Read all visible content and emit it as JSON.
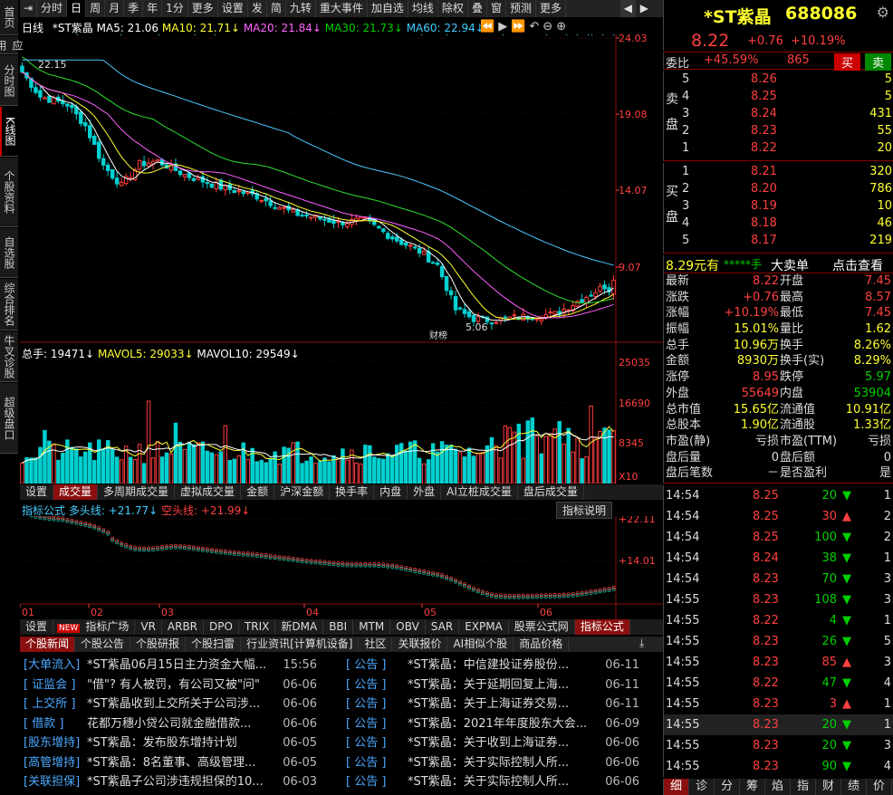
{
  "vtabs": [
    {
      "label": "首页"
    },
    {
      "label": "应用"
    },
    {
      "label": "分时图"
    },
    {
      "label": "K线图"
    },
    {
      "label": "个股资料"
    },
    {
      "label": "自选股"
    },
    {
      "label": "综合排名"
    },
    {
      "label": "牛叉诊股"
    },
    {
      "label": "超级盘口"
    }
  ],
  "toolbar": [
    "分时",
    "日",
    "周",
    "月",
    "季",
    "年",
    "1分",
    "更多",
    "设置",
    "",
    "发",
    "简",
    "九转",
    "重大事件",
    "",
    "加自选",
    "均线",
    "除权",
    "叠",
    "窗",
    "预测",
    "更多"
  ],
  "toolbar_active": "日",
  "ma_line": {
    "type": "日线",
    "name": "*ST紫晶",
    "ma5": "MA5: 21.06",
    "ma10": "MA10: 21.71",
    "ma20": "MA20: 21.84",
    "ma30": "MA30: 21.73",
    "ma60": "MA60: 22.94"
  },
  "price_axis": [
    "24.03",
    "19.08",
    "14.07",
    "9.07"
  ],
  "price_high_label": "22.15",
  "price_low_label": "5.06",
  "event_label": "财榜",
  "vol_header": {
    "total": "总手: 19471",
    "mavol5": "MAVOL5: 29033",
    "mavol10": "MAVOL10: 29549"
  },
  "vol_axis": [
    "25035",
    "16690",
    "8345",
    "X10"
  ],
  "vol_tabs": [
    "设置",
    "成交量",
    "多周期成交量",
    "虚拟成交量",
    "金额",
    "沪深金额",
    "换手率",
    "内盘",
    "外盘",
    "AI立桩成交量",
    "盘后成交量"
  ],
  "vol_tab_active": "成交量",
  "ind_header": {
    "title": "指标公式",
    "long": "多头线: +21.77",
    "short": "空头线: +21.99",
    "explain": "指标说明"
  },
  "ind_axis": [
    "+22.11",
    "+14.01"
  ],
  "months": [
    "01",
    "02",
    "03",
    "04",
    "05",
    "06"
  ],
  "ind_tabs": [
    "设置",
    "指标广场",
    "VR",
    "ARBR",
    "DPO",
    "TRIX",
    "新DMA",
    "BBI",
    "MTM",
    "OBV",
    "SAR",
    "EXPMA",
    "股票公式网",
    "指标公式"
  ],
  "ind_tab_active": "指标公式",
  "ind_new": "NEW",
  "news_tabs": [
    "个股新闻",
    "个股公告",
    "个股研报",
    "个股扫雷",
    "行业资讯[计算机设备]",
    "社区",
    "关联报价",
    "AI相似个股",
    "商品价格"
  ],
  "news_left": [
    {
      "tag": "[大单流入]",
      "title": "*ST紫晶06月15日主力资金大幅...",
      "date": "15:56"
    },
    {
      "tag": "[ 证监会 ]",
      "title": "\"借\"? 有人被罚，有公司又被\"问\"",
      "date": "06-06"
    },
    {
      "tag": "[ 上交所 ]",
      "title": "*ST紫晶收到上交所关于公司涉...",
      "date": "06-06"
    },
    {
      "tag": "[  借款  ]",
      "title": "花都万穗小贷公司就金融借款...",
      "date": "06-06"
    },
    {
      "tag": "[股东增持]",
      "title": "*ST紫晶：发布股东增持计划",
      "date": "06-05"
    },
    {
      "tag": "[高管增持]",
      "title": "*ST紫晶：8名董事、高级管理...",
      "date": "06-05"
    },
    {
      "tag": "[关联担保]",
      "title": "*ST紫晶子公司涉违规担保的10...",
      "date": "06-03"
    }
  ],
  "news_right": [
    {
      "tag": "[  公告  ]",
      "title": "*ST紫晶：中信建投证券股份...",
      "date": "06-11"
    },
    {
      "tag": "[  公告  ]",
      "title": "*ST紫晶：关于延期回复上海...",
      "date": "06-11"
    },
    {
      "tag": "[  公告  ]",
      "title": "*ST紫晶：关于上海证券交易...",
      "date": "06-11"
    },
    {
      "tag": "[  公告  ]",
      "title": "*ST紫晶：2021年年度股东大会...",
      "date": "06-09"
    },
    {
      "tag": "[  公告  ]",
      "title": "*ST紫晶：关于收到上海证券...",
      "date": "06-06"
    },
    {
      "tag": "[  公告  ]",
      "title": "*ST紫晶：关于实际控制人所...",
      "date": "06-06"
    },
    {
      "tag": "[  公告  ]",
      "title": "*ST紫晶：关于实际控制人所...",
      "date": "06-06"
    }
  ],
  "quote": {
    "name": "*ST紫晶",
    "code": "688086",
    "price": "8.22",
    "change": "+0.76",
    "pct": "+10.19%"
  },
  "weibi": {
    "label": "委比",
    "value": "+45.59%",
    "diff": "865",
    "buy": "买",
    "sell": "卖"
  },
  "asks": [
    {
      "lvl": "5",
      "price": "8.26",
      "vol": "5"
    },
    {
      "lvl": "4",
      "price": "8.25",
      "vol": "5"
    },
    {
      "lvl": "3",
      "price": "8.24",
      "vol": "431"
    },
    {
      "lvl": "2",
      "price": "8.23",
      "vol": "55"
    },
    {
      "lvl": "1",
      "price": "8.22",
      "vol": "20"
    }
  ],
  "bids": [
    {
      "lvl": "1",
      "price": "8.21",
      "vol": "320"
    },
    {
      "lvl": "2",
      "price": "8.20",
      "vol": "786"
    },
    {
      "lvl": "3",
      "price": "8.19",
      "vol": "10"
    },
    {
      "lvl": "4",
      "price": "8.18",
      "vol": "46"
    },
    {
      "lvl": "5",
      "price": "8.17",
      "vol": "219"
    }
  ],
  "ask_label": "卖盘",
  "bid_label": "买盘",
  "bigorder": {
    "amount": "8.29元有",
    "stars": "*****手",
    "label": "大卖单",
    "link": "点击查看"
  },
  "stats": [
    [
      "最新",
      "8.22",
      "开盘",
      "7.45"
    ],
    [
      "涨跌",
      "+0.76",
      "最高",
      "8.57"
    ],
    [
      "涨幅",
      "+10.19%",
      "最低",
      "7.45"
    ],
    [
      "振幅",
      "15.01%",
      "量比",
      "1.62"
    ],
    [
      "总手",
      "10.96万",
      "换手",
      "8.26%"
    ],
    [
      "金额",
      "8930万",
      "换手(实)",
      "8.29%"
    ],
    [
      "涨停",
      "8.95",
      "跌停",
      "5.97"
    ],
    [
      "外盘",
      "55649",
      "内盘",
      "53904"
    ],
    [
      "总市值",
      "15.65亿",
      "流通值",
      "10.91亿"
    ],
    [
      "总股本",
      "1.90亿",
      "流通股",
      "1.33亿"
    ],
    [
      "市盈(静)",
      "亏损",
      "市盈(TTM)",
      "亏损"
    ],
    [
      "盘后量",
      "0",
      "盘后额",
      "0"
    ],
    [
      "盘后笔数",
      "－",
      "是否盈利",
      "是"
    ]
  ],
  "ticks": [
    {
      "t": "14:54",
      "p": "8.25",
      "v": "20",
      "d": "down",
      "n": "1"
    },
    {
      "t": "14:54",
      "p": "8.25",
      "v": "30",
      "d": "up",
      "n": "2"
    },
    {
      "t": "14:54",
      "p": "8.25",
      "v": "100",
      "d": "down",
      "n": "2"
    },
    {
      "t": "14:54",
      "p": "8.24",
      "v": "38",
      "d": "down",
      "n": "1"
    },
    {
      "t": "14:54",
      "p": "8.23",
      "v": "70",
      "d": "down",
      "n": "3"
    },
    {
      "t": "14:55",
      "p": "8.23",
      "v": "108",
      "d": "down",
      "n": "3"
    },
    {
      "t": "14:55",
      "p": "8.22",
      "v": "4",
      "d": "down",
      "n": "1"
    },
    {
      "t": "14:55",
      "p": "8.23",
      "v": "26",
      "d": "down",
      "n": "5"
    },
    {
      "t": "14:55",
      "p": "8.23",
      "v": "85",
      "d": "up",
      "n": "3"
    },
    {
      "t": "14:55",
      "p": "8.22",
      "v": "47",
      "d": "down",
      "n": "4"
    },
    {
      "t": "14:55",
      "p": "8.23",
      "v": "3",
      "d": "up",
      "n": "1"
    },
    {
      "t": "14:55",
      "p": "8.23",
      "v": "20",
      "d": "down",
      "n": "1"
    },
    {
      "t": "14:55",
      "p": "8.23",
      "v": "20",
      "d": "down",
      "n": "3"
    },
    {
      "t": "14:55",
      "p": "8.23",
      "v": "90",
      "d": "down",
      "n": "4"
    }
  ],
  "bottom_tabs": [
    "细",
    "诊",
    "分",
    "筹",
    "焰",
    "指",
    "财",
    "绩",
    "价"
  ],
  "colors": {
    "up": "#ff3c3c",
    "down": "#00d0d0",
    "ma5": "#ffffff",
    "ma10": "#ffff30",
    "ma20": "#ff60ff",
    "ma30": "#30e030",
    "ma60": "#4cc8ff"
  }
}
